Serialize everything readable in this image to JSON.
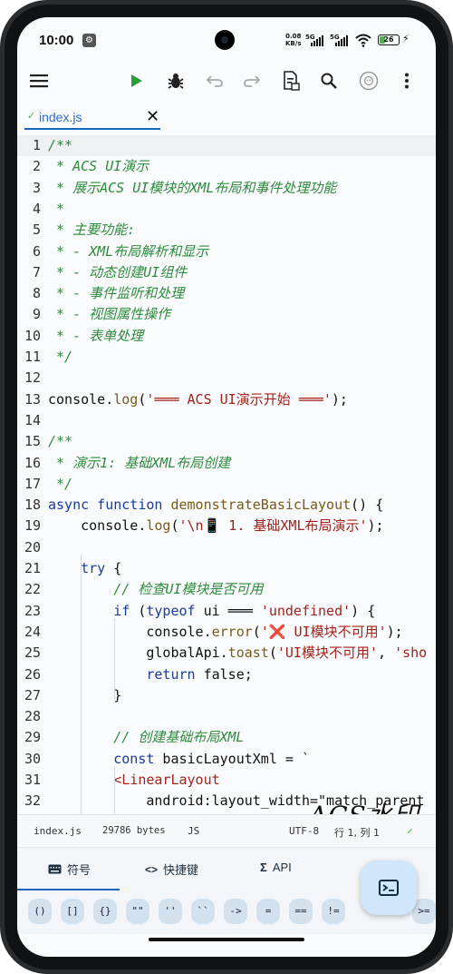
{
  "status_bar": {
    "time": "10:00",
    "net_speed_value": "0.08",
    "net_speed_unit": "KB/s",
    "signal_1": "5G",
    "signal_2": "5G",
    "battery": "26"
  },
  "toolbar": {
    "icons": [
      "menu-icon",
      "run-icon",
      "debug-icon",
      "undo-icon",
      "redo-icon",
      "file-info-icon",
      "search-icon",
      "ai-icon",
      "more-icon"
    ]
  },
  "tab": {
    "name": "index.js"
  },
  "editor": {
    "current_line": 1,
    "lines": [
      {
        "n": "1",
        "parts": [
          [
            "c",
            "/**"
          ]
        ]
      },
      {
        "n": "2",
        "parts": [
          [
            "c",
            " * ACS UI演示"
          ]
        ]
      },
      {
        "n": "3",
        "parts": [
          [
            "c",
            " * 展示ACS UI模块的XML布局和事件处理功能"
          ]
        ]
      },
      {
        "n": "4",
        "parts": [
          [
            "c",
            " *"
          ]
        ]
      },
      {
        "n": "5",
        "parts": [
          [
            "c",
            " * 主要功能:"
          ]
        ]
      },
      {
        "n": "6",
        "parts": [
          [
            "c",
            " * - XML布局解析和显示"
          ]
        ]
      },
      {
        "n": "7",
        "parts": [
          [
            "c",
            " * - 动态创建UI组件"
          ]
        ]
      },
      {
        "n": "8",
        "parts": [
          [
            "c",
            " * - 事件监听和处理"
          ]
        ]
      },
      {
        "n": "9",
        "parts": [
          [
            "c",
            " * - 视图属性操作"
          ]
        ]
      },
      {
        "n": "10",
        "parts": [
          [
            "c",
            " * - 表单处理"
          ]
        ]
      },
      {
        "n": "11",
        "parts": [
          [
            "c",
            " */"
          ]
        ]
      },
      {
        "n": "12",
        "parts": []
      },
      {
        "n": "13",
        "parts": [
          [
            "p",
            "console."
          ],
          [
            "f",
            "log"
          ],
          [
            "p",
            "("
          ],
          [
            "s",
            "'═══ ACS UI演示开始 ═══'"
          ],
          [
            "p",
            ");"
          ]
        ]
      },
      {
        "n": "14",
        "parts": []
      },
      {
        "n": "15",
        "parts": [
          [
            "c",
            "/**"
          ]
        ]
      },
      {
        "n": "16",
        "parts": [
          [
            "c",
            " * 演示1: 基础XML布局创建"
          ]
        ]
      },
      {
        "n": "17",
        "parts": [
          [
            "c",
            " */"
          ]
        ]
      },
      {
        "n": "18",
        "parts": [
          [
            "k",
            "async function "
          ],
          [
            "f",
            "demonstrateBasicLayout"
          ],
          [
            "p",
            "() {"
          ]
        ]
      },
      {
        "n": "19",
        "parts": [
          [
            "p",
            "    console."
          ],
          [
            "f",
            "log"
          ],
          [
            "p",
            "("
          ],
          [
            "s",
            "'\\n📱 1. 基础XML布局演示'"
          ],
          [
            "p",
            ");"
          ]
        ]
      },
      {
        "n": "20",
        "parts": []
      },
      {
        "n": "21",
        "parts": [
          [
            "k",
            "    try"
          ],
          [
            "p",
            " {"
          ]
        ]
      },
      {
        "n": "22",
        "parts": [
          [
            "c",
            "        // 检查UI模块是否可用"
          ]
        ]
      },
      {
        "n": "23",
        "parts": [
          [
            "k",
            "        if"
          ],
          [
            "p",
            " ("
          ],
          [
            "k",
            "typeof"
          ],
          [
            "p",
            " ui ═══ "
          ],
          [
            "s",
            "'undefined'"
          ],
          [
            "p",
            ") {"
          ]
        ]
      },
      {
        "n": "24",
        "parts": [
          [
            "p",
            "            console."
          ],
          [
            "f",
            "error"
          ],
          [
            "p",
            "("
          ],
          [
            "s",
            "'❌ UI模块不可用'"
          ],
          [
            "p",
            ");"
          ]
        ]
      },
      {
        "n": "25",
        "parts": [
          [
            "p",
            "            globalApi."
          ],
          [
            "f",
            "toast"
          ],
          [
            "p",
            "("
          ],
          [
            "s",
            "'UI模块不可用'"
          ],
          [
            "p",
            ", "
          ],
          [
            "s",
            "'sho"
          ]
        ]
      },
      {
        "n": "26",
        "parts": [
          [
            "k",
            "            return"
          ],
          [
            "p",
            " false;"
          ]
        ]
      },
      {
        "n": "27",
        "parts": [
          [
            "p",
            "        }"
          ]
        ]
      },
      {
        "n": "28",
        "parts": []
      },
      {
        "n": "29",
        "parts": [
          [
            "c",
            "        // 创建基础布局XML"
          ]
        ]
      },
      {
        "n": "30",
        "parts": [
          [
            "k",
            "        const"
          ],
          [
            "p",
            " basicLayoutXml = `"
          ]
        ]
      },
      {
        "n": "31",
        "parts": [
          [
            "tag",
            "        <LinearLayout"
          ]
        ]
      },
      {
        "n": "32",
        "parts": [
          [
            "attr",
            "            android:layout_width=\"match_parent"
          ]
        ]
      }
    ]
  },
  "watermark": "ACS水印",
  "info_bar": {
    "file": "index.js",
    "size": "29786 bytes",
    "lang": "JS",
    "encoding": "UTF-8",
    "position": "行 1, 列 1"
  },
  "bottom_tabs": [
    {
      "icon": "keyboard-icon",
      "label": "符号"
    },
    {
      "icon": "code-icon",
      "label": "快捷键"
    },
    {
      "icon": "sigma-icon",
      "label": "API"
    }
  ],
  "symbols": [
    "()",
    "[]",
    "{}",
    "\"\"",
    "''",
    "``",
    "->",
    "=",
    "==",
    "!=",
    ">="
  ]
}
